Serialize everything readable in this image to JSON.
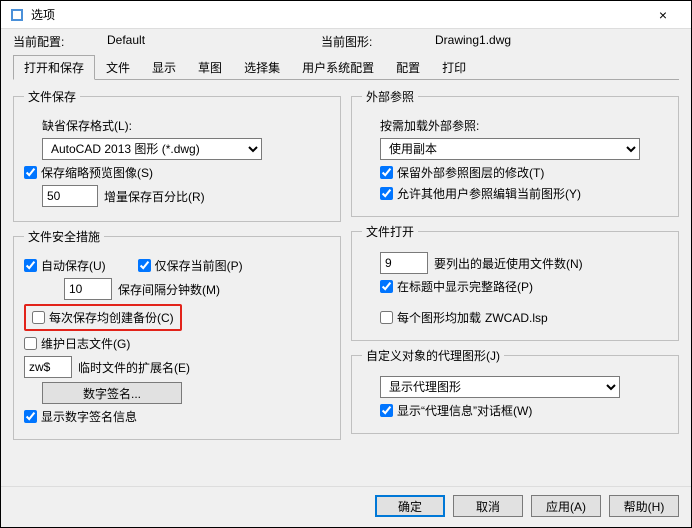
{
  "window": {
    "title": "选项"
  },
  "config": {
    "current_label": "当前配置:",
    "current_value": "Default",
    "drawing_label": "当前图形:",
    "drawing_value": "Drawing1.dwg"
  },
  "tabs": [
    "打开和保存",
    "文件",
    "显示",
    "草图",
    "选择集",
    "用户系统配置",
    "配置",
    "打印"
  ],
  "left": {
    "filesave": {
      "legend": "文件保存",
      "default_format_label": "缺省保存格式(L):",
      "format_value": "AutoCAD 2013 图形 (*.dwg)",
      "thumbnail_label": "保存缩略预览图像(S)",
      "increment_value": "50",
      "increment_label": "增量保存百分比(R)"
    },
    "safety": {
      "legend": "文件安全措施",
      "autosave_label": "自动保存(U)",
      "current_only_label": "仅保存当前图(P)",
      "interval_value": "10",
      "interval_label": "保存间隔分钟数(M)",
      "backup_label": "每次保存均创建备份(C)",
      "log_label": "维护日志文件(G)",
      "temp_ext_value": "zw$",
      "temp_ext_label": "临时文件的扩展名(E)",
      "sig_button": "数字签名...",
      "show_sig_label": "显示数字签名信息"
    }
  },
  "right": {
    "xref": {
      "legend": "外部参照",
      "ondemand_label": "按需加载外部参照:",
      "ondemand_value": "使用副本",
      "keep_layer_label": "保留外部参照图层的修改(T)",
      "allow_edit_label": "允许其他用户参照编辑当前图形(Y)"
    },
    "open": {
      "legend": "文件打开",
      "mru_value": "9",
      "mru_label": "要列出的最近使用文件数(N)",
      "fullpath_label": "在标题中显示完整路径(P)",
      "load_lsp_label": "每个图形均加载",
      "load_lsp_file": "ZWCAD.lsp"
    },
    "proxy": {
      "legend": "自定义对象的代理图形(J)",
      "proxy_value": "显示代理图形",
      "show_dialog_label": "显示“代理信息”对话框(W)"
    }
  },
  "buttons": {
    "ok": "确定",
    "cancel": "取消",
    "apply": "应用(A)",
    "help": "帮助(H)"
  }
}
